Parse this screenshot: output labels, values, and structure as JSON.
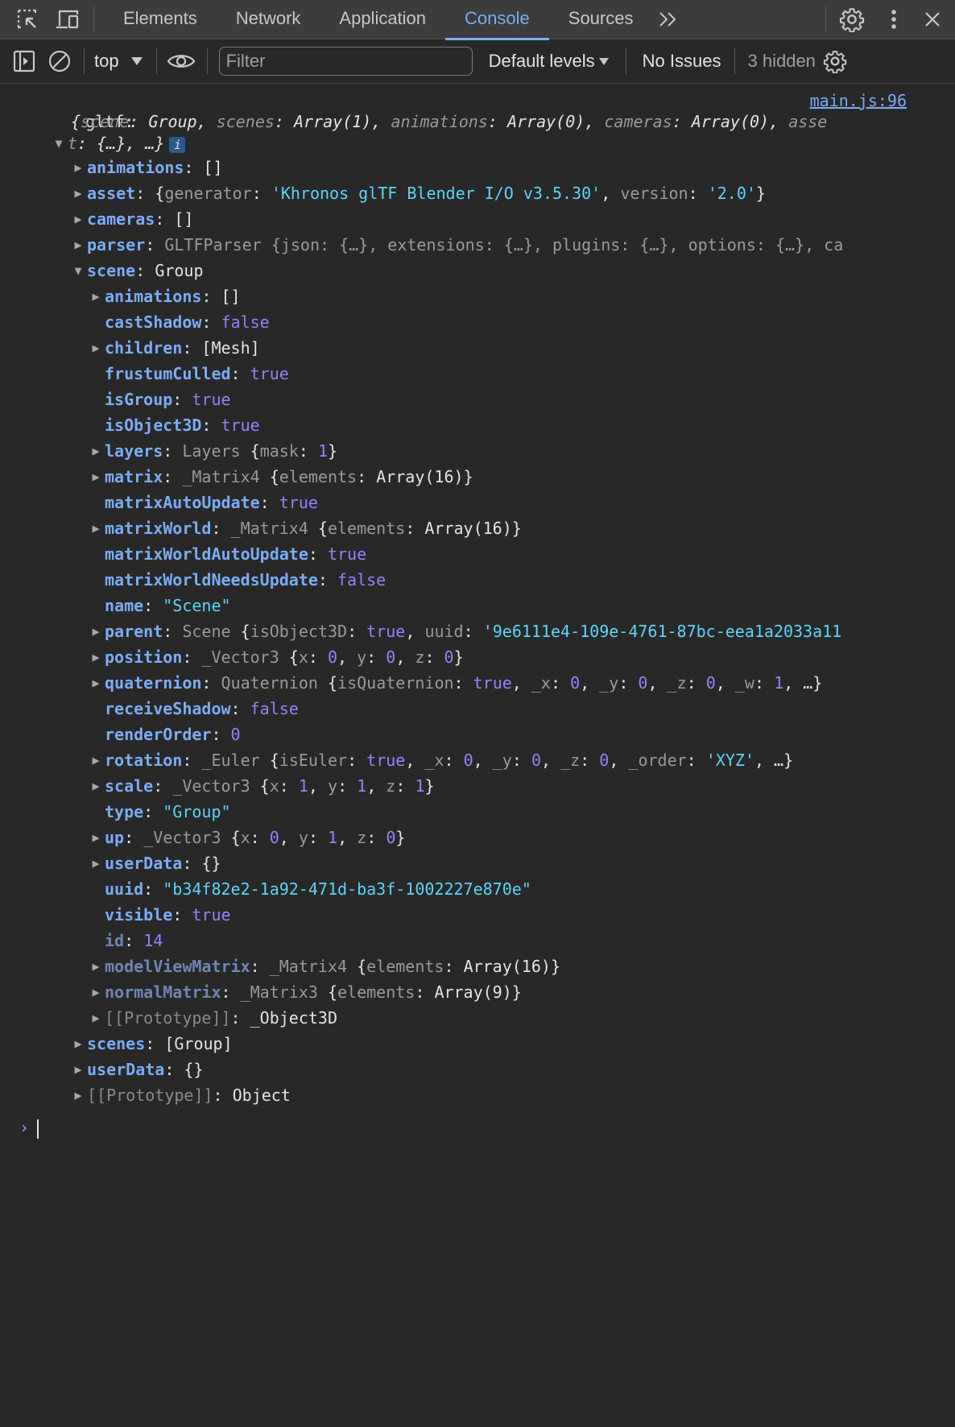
{
  "tabbar": {
    "tabs": [
      {
        "label": "Elements",
        "active": false
      },
      {
        "label": "Network",
        "active": false
      },
      {
        "label": "Application",
        "active": false
      },
      {
        "label": "Console",
        "active": true
      },
      {
        "label": "Sources",
        "active": false
      }
    ],
    "more_tabs": "»"
  },
  "toolbar": {
    "context": "top",
    "filter_placeholder": "Filter",
    "filter_value": "",
    "levels": "Default levels",
    "issues": "No Issues",
    "hidden": "3 hidden"
  },
  "console": {
    "label": "gltf:",
    "source": "main.js:96",
    "summary_line1": {
      "k1": "scene",
      "v1": "Group",
      "k2": "scenes",
      "v2": "Array(1)",
      "k3": "animations",
      "v3": "Array(0)",
      "k4": "cameras",
      "v4": "Array(0)",
      "k5_part": "asse"
    },
    "summary_line2": {
      "k5_rest": "t",
      "v5": "{…}",
      "more": "…"
    },
    "info": "i",
    "root": {
      "animations": {
        "key": "animations",
        "value": "[]"
      },
      "asset": {
        "key": "asset",
        "k1": "generator",
        "v1": "'Khronos glTF Blender I/O v3.5.30'",
        "k2": "version",
        "v2": "'2.0'"
      },
      "cameras": {
        "key": "cameras",
        "value": "[]"
      },
      "parser": {
        "key": "parser",
        "cls": "GLTFParser",
        "rest": "{json: {…}, extensions: {…}, plugins: {…}, options: {…}, ca"
      },
      "scene": {
        "key": "scene",
        "value": "Group"
      },
      "scenes": {
        "key": "scenes",
        "value": "[Group]"
      },
      "userData": {
        "key": "userData",
        "value": "{}"
      },
      "prototype": {
        "key": "[[Prototype]]",
        "value": "Object"
      }
    },
    "scene": {
      "animations": {
        "key": "animations",
        "value": "[]"
      },
      "castShadow": {
        "key": "castShadow",
        "value": "false"
      },
      "children": {
        "key": "children",
        "value": "[Mesh]"
      },
      "frustumCulled": {
        "key": "frustumCulled",
        "value": "true"
      },
      "isGroup": {
        "key": "isGroup",
        "value": "true"
      },
      "isObject3D": {
        "key": "isObject3D",
        "value": "true"
      },
      "layers": {
        "key": "layers",
        "cls": "Layers",
        "k1": "mask",
        "v1": "1"
      },
      "matrix": {
        "key": "matrix",
        "cls": "_Matrix4",
        "k1": "elements",
        "v1": "Array(16)"
      },
      "matrixAutoUpdate": {
        "key": "matrixAutoUpdate",
        "value": "true"
      },
      "matrixWorld": {
        "key": "matrixWorld",
        "cls": "_Matrix4",
        "k1": "elements",
        "v1": "Array(16)"
      },
      "matrixWorldAutoUpdate": {
        "key": "matrixWorldAutoUpdate",
        "value": "true"
      },
      "matrixWorldNeedsUpdate": {
        "key": "matrixWorldNeedsUpdate",
        "value": "false"
      },
      "name": {
        "key": "name",
        "value": "\"Scene\""
      },
      "parent": {
        "key": "parent",
        "cls": "Scene",
        "k1": "isObject3D",
        "v1": "true",
        "k2": "uuid",
        "v2": "'9e6111e4-109e-4761-87bc-eea1a2033a11"
      },
      "position": {
        "key": "position",
        "cls": "_Vector3",
        "x": "0",
        "y": "0",
        "z": "0"
      },
      "quaternion": {
        "key": "quaternion",
        "cls": "Quaternion",
        "k1": "isQuaternion",
        "v1": "true",
        "x": "0",
        "y": "0",
        "z": "0",
        "w": "1"
      },
      "receiveShadow": {
        "key": "receiveShadow",
        "value": "false"
      },
      "renderOrder": {
        "key": "renderOrder",
        "value": "0"
      },
      "rotation": {
        "key": "rotation",
        "cls": "_Euler",
        "k1": "isEuler",
        "v1": "true",
        "x": "0",
        "y": "0",
        "z": "0",
        "order": "'XYZ'"
      },
      "scale": {
        "key": "scale",
        "cls": "_Vector3",
        "x": "1",
        "y": "1",
        "z": "1"
      },
      "type": {
        "key": "type",
        "value": "\"Group\""
      },
      "up": {
        "key": "up",
        "cls": "_Vector3",
        "x": "0",
        "y": "1",
        "z": "0"
      },
      "userData": {
        "key": "userData",
        "value": "{}"
      },
      "uuid": {
        "key": "uuid",
        "value": "\"b34f82e2-1a92-471d-ba3f-1002227e870e\""
      },
      "visible": {
        "key": "visible",
        "value": "true"
      },
      "id": {
        "key": "id",
        "value": "14"
      },
      "modelViewMatrix": {
        "key": "modelViewMatrix",
        "cls": "_Matrix4",
        "k1": "elements",
        "v1": "Array(16)"
      },
      "normalMatrix": {
        "key": "normalMatrix",
        "cls": "_Matrix3",
        "k1": "elements",
        "v1": "Array(9)"
      },
      "prototype": {
        "key": "[[Prototype]]",
        "value": "_Object3D"
      }
    },
    "prompt": "›"
  }
}
